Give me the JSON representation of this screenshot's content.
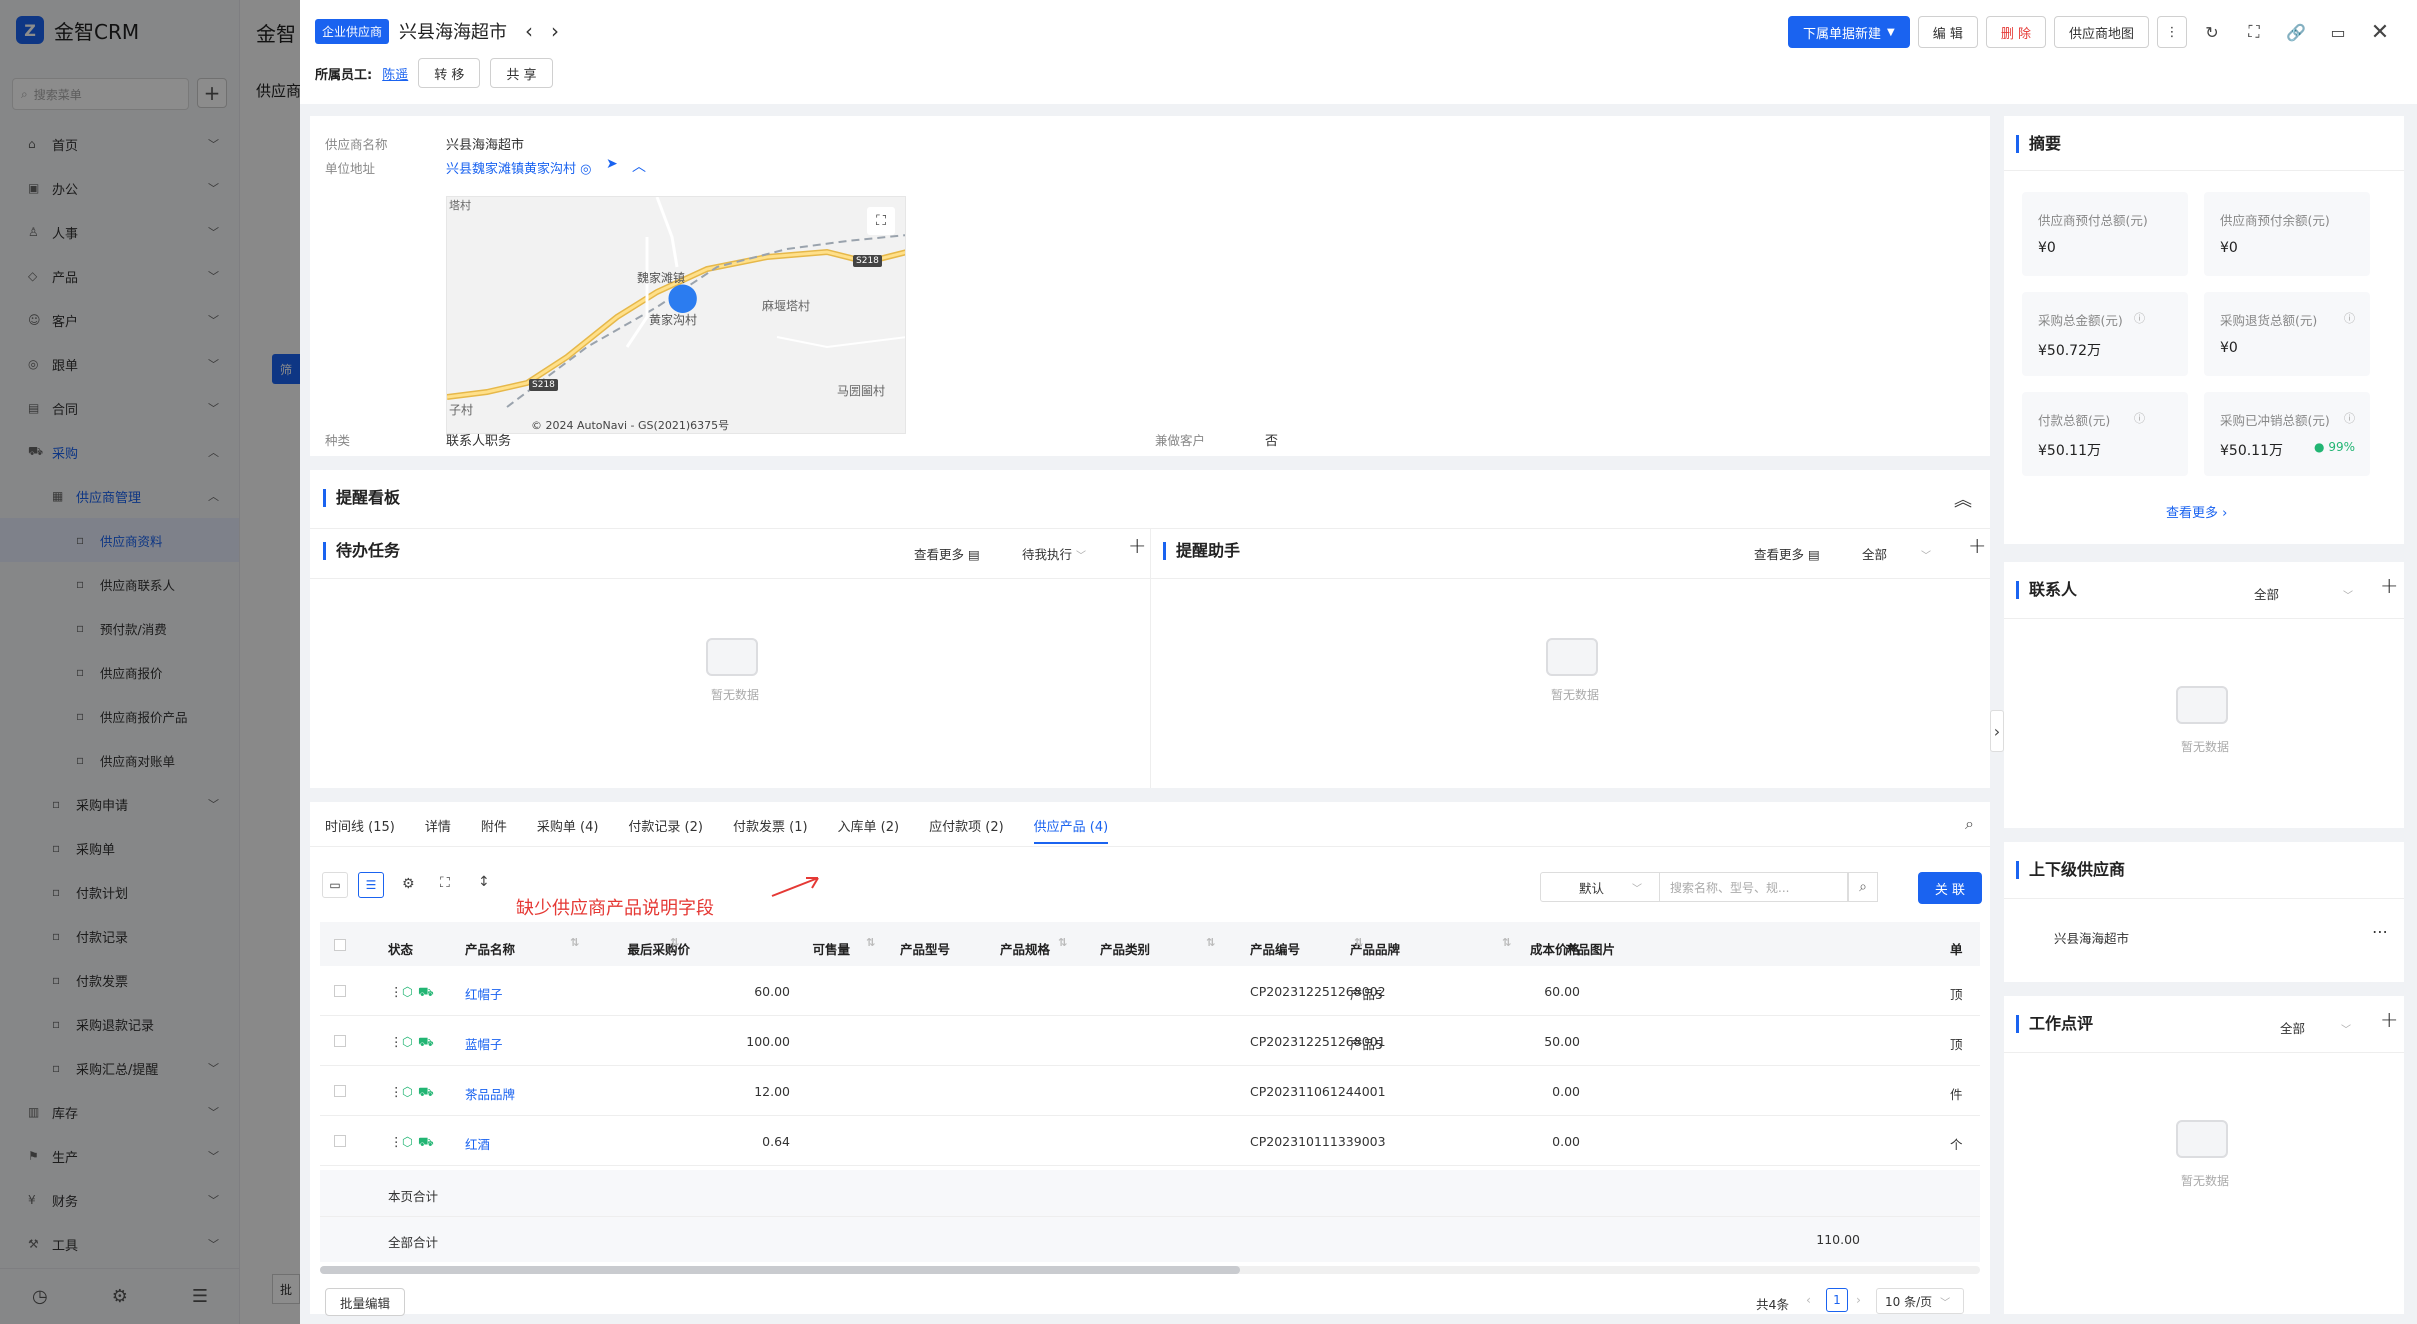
{
  "app": {
    "brand": "金智CRM",
    "search_placeholder": "搜索菜单"
  },
  "sidebar": {
    "items": [
      {
        "label": "首页",
        "icon": "home-icon"
      },
      {
        "label": "办公",
        "icon": "office-icon"
      },
      {
        "label": "人事",
        "icon": "person-icon"
      },
      {
        "label": "产品",
        "icon": "product-icon"
      },
      {
        "label": "客户",
        "icon": "customer-icon"
      },
      {
        "label": "跟单",
        "icon": "follow-icon"
      },
      {
        "label": "合同",
        "icon": "contract-icon"
      },
      {
        "label": "采购",
        "icon": "cart-icon"
      },
      {
        "label": "供应商管理",
        "icon": "supplier-icon"
      },
      {
        "label": "供应商资料",
        "icon": "doc-icon"
      },
      {
        "label": "供应商联系人",
        "icon": "doc-icon"
      },
      {
        "label": "预付款/消费",
        "icon": "doc-icon"
      },
      {
        "label": "供应商报价",
        "icon": "doc-icon"
      },
      {
        "label": "供应商报价产品",
        "icon": "doc-icon"
      },
      {
        "label": "供应商对账单",
        "icon": "doc-icon"
      },
      {
        "label": "采购申请",
        "icon": "doc-icon"
      },
      {
        "label": "采购单",
        "icon": "doc-icon"
      },
      {
        "label": "付款计划",
        "icon": "doc-icon"
      },
      {
        "label": "付款记录",
        "icon": "doc-icon"
      },
      {
        "label": "付款发票",
        "icon": "doc-icon"
      },
      {
        "label": "采购退款记录",
        "icon": "doc-icon"
      },
      {
        "label": "采购汇总/提醒",
        "icon": "doc-icon"
      },
      {
        "label": "库存",
        "icon": "stock-icon"
      },
      {
        "label": "生产",
        "icon": "factory-icon"
      },
      {
        "label": "财务",
        "icon": "finance-icon"
      },
      {
        "label": "工具",
        "icon": "tool-icon"
      }
    ]
  },
  "background": {
    "title": "金智",
    "subtab": "供应商",
    "filter_btn": "筛",
    "batch_btn": "批"
  },
  "header": {
    "tag": "企业供应商",
    "title": "兴县海海超市",
    "owner_label": "所属员工:",
    "owner_value": "陈遥",
    "transfer": "转 移",
    "share": "共 享",
    "new_doc": "下属单据新建",
    "edit": "编 辑",
    "delete": "删 除",
    "map_btn": "供应商地图"
  },
  "info": {
    "name_label": "供应商名称",
    "name_value": "兴县海海超市",
    "addr_label": "单位地址",
    "addr_value": "兴县魏家滩镇黄家沟村",
    "type_label": "种类",
    "type_value": "联系人职务",
    "also_customer_label": "兼做客户",
    "also_customer_value": "否",
    "map_labels": {
      "l1": "塔村",
      "l2": "魏家滩镇",
      "l3": "黄家沟村",
      "l4": "麻堰塔村",
      "l5": "马圐圙村",
      "l6": "子村",
      "road1": "S218",
      "road2": "S218",
      "copyright": "© 2024 AutoNavi - GS(2021)6375号"
    }
  },
  "reminder": {
    "title": "提醒看板",
    "todo_title": "待办任务",
    "todo_more": "查看更多",
    "todo_filter": "待我执行",
    "helper_title": "提醒助手",
    "helper_more": "查看更多",
    "helper_filter": "全部",
    "empty": "暂无数据"
  },
  "tabs": [
    {
      "label": "时间线 (15)"
    },
    {
      "label": "详情"
    },
    {
      "label": "附件"
    },
    {
      "label": "采购单 (4)"
    },
    {
      "label": "付款记录 (2)"
    },
    {
      "label": "付款发票 (1)"
    },
    {
      "label": "入库单 (2)"
    },
    {
      "label": "应付款项 (2)"
    },
    {
      "label": "供应产品 (4)"
    }
  ],
  "toolbar": {
    "annotation": "缺少供应商产品说明字段",
    "sort_default": "默认",
    "search_placeholder": "搜索名称、型号、规...",
    "link_btn": "关 联"
  },
  "table": {
    "headers": [
      "状态",
      "产品名称",
      "最后采购价",
      "可售量",
      "产品型号",
      "产品规格",
      "产品类别",
      "产品编号",
      "产品品牌",
      "成本价格",
      "产品图片",
      "单"
    ],
    "rows": [
      {
        "name": "红帽子",
        "price": "60.00",
        "code": "CP202312251268002",
        "brand": "产品5",
        "cost": "60.00",
        "unit": "顶"
      },
      {
        "name": "蓝帽子",
        "price": "100.00",
        "code": "CP202312251268001",
        "brand": "产品5",
        "cost": "50.00",
        "unit": "顶"
      },
      {
        "name": "茶品品牌",
        "price": "12.00",
        "code": "CP202311061244001",
        "brand": "",
        "cost": "0.00",
        "unit": "件"
      },
      {
        "name": "红酒",
        "price": "0.64",
        "code": "CP202310111339003",
        "brand": "",
        "cost": "0.00",
        "unit": "个"
      }
    ],
    "page_total_label": "本页合计",
    "all_total_label": "全部合计",
    "all_total_cost": "110.00"
  },
  "pagination": {
    "batch_edit": "批量编辑",
    "total": "共4条",
    "page": "1",
    "page_size": "10 条/页"
  },
  "summary": {
    "title": "摘要",
    "cards": [
      {
        "label": "供应商预付总额(元)",
        "value": "¥0"
      },
      {
        "label": "供应商预付余额(元)",
        "value": "¥0"
      },
      {
        "label": "采购总金额(元)",
        "value": "¥50.72万"
      },
      {
        "label": "采购退货总额(元)",
        "value": "¥0"
      },
      {
        "label": "付款总额(元)",
        "value": "¥50.11万"
      },
      {
        "label": "采购已冲销总额(元)",
        "value": "¥50.11万"
      }
    ],
    "percent": "99%",
    "more": "查看更多"
  },
  "contacts": {
    "title": "联系人",
    "filter": "全部",
    "empty": "暂无数据"
  },
  "related": {
    "title": "上下级供应商",
    "item": "兴县海海超市"
  },
  "review": {
    "title": "工作点评",
    "filter": "全部",
    "empty": "暂无数据"
  },
  "colors": {
    "accent": "#1a63f0",
    "danger": "#e53935",
    "annotation": "#e53935",
    "success": "#22b573"
  }
}
